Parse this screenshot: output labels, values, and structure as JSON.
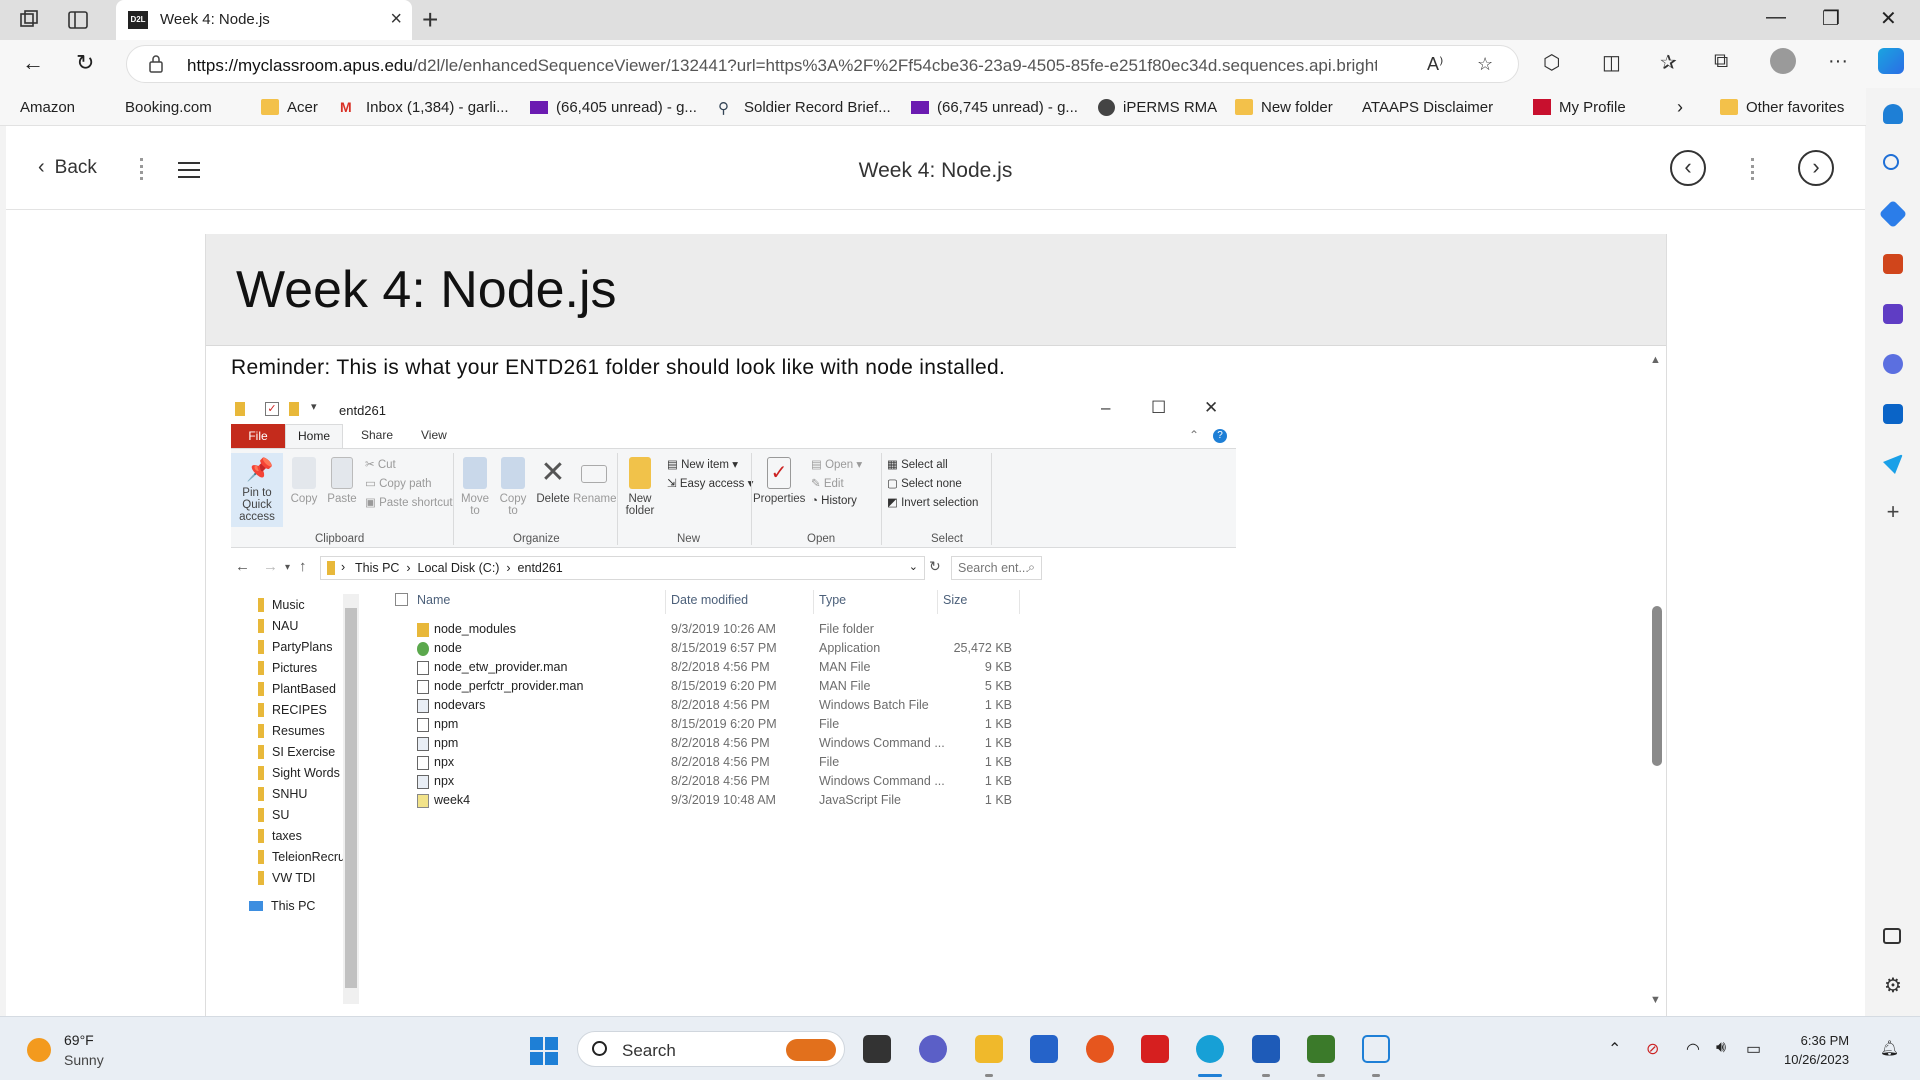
{
  "browser": {
    "tab_title": "Week 4: Node.js",
    "tab_favicon_text": "D2L",
    "url_host": "https://myclassroom.apus.edu",
    "url_path": "/d2l/le/enhancedSequenceViewer/132441?url=https%3A%2F%2Ff54cbe36-23a9-4505-85fe-e251f80ec34d.sequences.api.bright..."
  },
  "favorites": [
    {
      "label": "Amazon",
      "icon": "page-icon"
    },
    {
      "label": "Booking.com",
      "icon": "page-icon"
    },
    {
      "label": "Acer",
      "icon": "folder-icon"
    },
    {
      "label": "Inbox (1,384) - garli...",
      "icon": "gmail-icon"
    },
    {
      "label": "(66,405 unread) - g...",
      "icon": "mail-icon"
    },
    {
      "label": "Soldier Record Brief...",
      "icon": "soldier-icon"
    },
    {
      "label": "(66,745 unread) - g...",
      "icon": "mail-icon"
    },
    {
      "label": "iPERMS RMA",
      "icon": "seal-icon"
    },
    {
      "label": "New folder",
      "icon": "folder-icon"
    },
    {
      "label": "ATAAPS Disclaimer",
      "icon": "page-icon"
    },
    {
      "label": "My Profile",
      "icon": "profile-icon"
    },
    {
      "label": "Other favorites",
      "icon": "folder-icon"
    }
  ],
  "page": {
    "back_label": "Back",
    "title": "Week 4: Node.js",
    "banner_title": "Week 4: Node.js",
    "reminder": "Reminder: This is what your ENTD261 folder should look like with node installed."
  },
  "explorer": {
    "window_title": "entd261",
    "tabs": {
      "file": "File",
      "home": "Home",
      "share": "Share",
      "view": "View"
    },
    "ribbon": {
      "pin": "Pin to Quick access",
      "copy": "Copy",
      "paste": "Paste",
      "cut": "Cut",
      "copy_path": "Copy path",
      "paste_shortcut": "Paste shortcut",
      "move_to": "Move to",
      "copy_to": "Copy to",
      "delete": "Delete",
      "rename": "Rename",
      "new_folder": "New folder",
      "new_item": "New item",
      "easy_access": "Easy access",
      "properties": "Properties",
      "open": "Open",
      "edit": "Edit",
      "history": "History",
      "select_all": "Select all",
      "select_none": "Select none",
      "invert_selection": "Invert selection",
      "groups": {
        "clipboard": "Clipboard",
        "organize": "Organize",
        "new": "New",
        "open": "Open",
        "select": "Select"
      }
    },
    "path": {
      "p1": "This PC",
      "p2": "Local Disk (C:)",
      "p3": "entd261"
    },
    "search_placeholder": "Search ent...",
    "tree": [
      "Music",
      "NAU",
      "PartyPlans",
      "Pictures",
      "PlantBased",
      "RECIPES",
      "Resumes",
      "SI Exercise",
      "Sight Words",
      "SNHU",
      "SU",
      "taxes",
      "TeleionRecruitir",
      "VW TDI"
    ],
    "tree_this_pc": "This PC",
    "columns": {
      "name": "Name",
      "date": "Date modified",
      "type": "Type",
      "size": "Size"
    },
    "files": [
      {
        "name": "node_modules",
        "date": "9/3/2019 10:26 AM",
        "type": "File folder",
        "size": "",
        "icon": "folder-icon"
      },
      {
        "name": "node",
        "date": "8/15/2019 6:57 PM",
        "type": "Application",
        "size": "25,472 KB",
        "icon": "node-app-icon"
      },
      {
        "name": "node_etw_provider.man",
        "date": "8/2/2018 4:56 PM",
        "type": "MAN File",
        "size": "9 KB",
        "icon": "file-icon"
      },
      {
        "name": "node_perfctr_provider.man",
        "date": "8/15/2019 6:20 PM",
        "type": "MAN File",
        "size": "5 KB",
        "icon": "file-icon"
      },
      {
        "name": "nodevars",
        "date": "8/2/2018 4:56 PM",
        "type": "Windows Batch File",
        "size": "1 KB",
        "icon": "batch-file-icon"
      },
      {
        "name": "npm",
        "date": "8/15/2019 6:20 PM",
        "type": "File",
        "size": "1 KB",
        "icon": "file-icon"
      },
      {
        "name": "npm",
        "date": "8/2/2018 4:56 PM",
        "type": "Windows Command ...",
        "size": "1 KB",
        "icon": "cmd-file-icon"
      },
      {
        "name": "npx",
        "date": "8/2/2018 4:56 PM",
        "type": "File",
        "size": "1 KB",
        "icon": "file-icon"
      },
      {
        "name": "npx",
        "date": "8/2/2018 4:56 PM",
        "type": "Windows Command ...",
        "size": "1 KB",
        "icon": "cmd-file-icon"
      },
      {
        "name": "week4",
        "date": "9/3/2019 10:48 AM",
        "type": "JavaScript File",
        "size": "1 KB",
        "icon": "js-file-icon"
      }
    ]
  },
  "taskbar": {
    "temp": "69°F",
    "condition": "Sunny",
    "search_label": "Search",
    "time": "6:36 PM",
    "date": "10/26/2023"
  },
  "colors": {
    "file_tab": "#c42b1c",
    "accent": "#1e7fd6",
    "folder": "#e8b83a"
  }
}
